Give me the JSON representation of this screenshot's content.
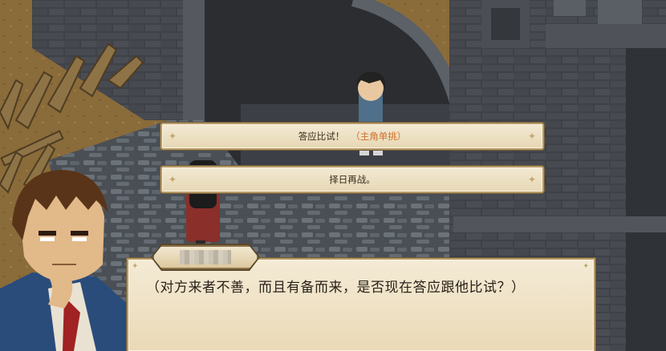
{
  "choices": [
    {
      "label": "答应比试！",
      "tag": "（主角单挑）"
    },
    {
      "label": "择日再战。"
    }
  ],
  "dialogue": {
    "text": "（对方来者不善，而且有备而来，是否现在答应跟他比试？）"
  },
  "colors": {
    "panel_bg": "#f0e4c8",
    "panel_border": "#b89a66",
    "accent_tag": "#d0702a",
    "text": "#2a2118"
  }
}
